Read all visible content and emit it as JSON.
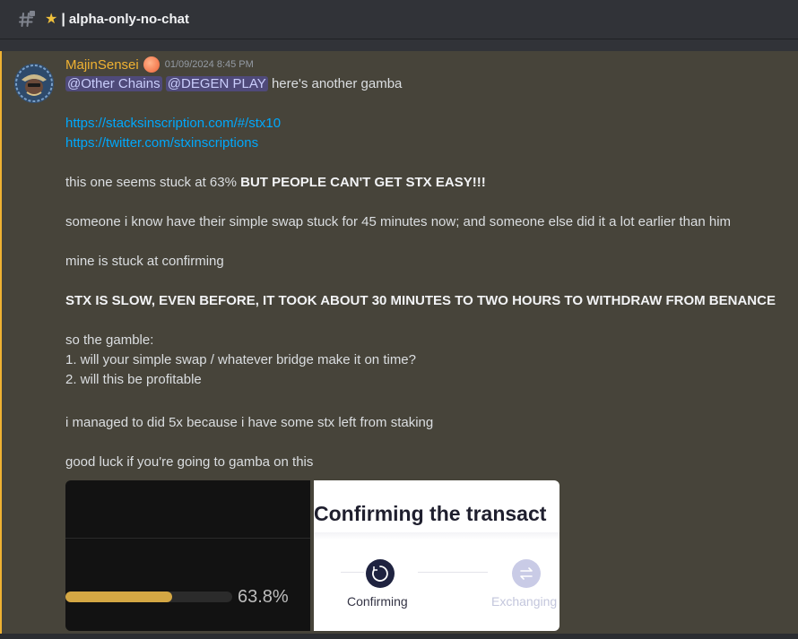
{
  "header": {
    "channel_icon": "text-channel-lock-icon",
    "star_icon": "star-icon",
    "separator": "|",
    "channel_name": "alpha-only-no-chat"
  },
  "message": {
    "username": "MajinSensei",
    "badge_icon": "peach-icon",
    "timestamp": "01/09/2024 8:45 PM",
    "mentions": [
      "@Other Chains",
      "@DEGEN PLAY"
    ],
    "first_line_rest": "here's another gamba",
    "links": [
      "https://stacksinscription.com/#/stx10",
      "https://twitter.com/stxinscriptions"
    ],
    "line_stuck_prefix": "this one seems stuck at 63% ",
    "line_stuck_bold": "BUT PEOPLE CAN'T GET STX EASY!!!",
    "line_someone": "someone i know have their simple swap stuck for 45 minutes now; and someone else did it a lot earlier than him",
    "line_mine": "mine is stuck at confirming",
    "line_stx_slow": "STX IS SLOW, EVEN BEFORE, IT TOOK ABOUT 30 MINUTES TO TWO HOURS TO WITHDRAW FROM BENANCE",
    "line_gamble": "so the gamble:",
    "line_q1": "1. will your simple swap / whatever bridge make it on time?",
    "line_q2": "2. will this be profitable",
    "line_managed": "i managed to did 5x because i have some stx left from staking",
    "line_luck": "good luck if you're going to gamba on this"
  },
  "attachment": {
    "progress_value": 0.638,
    "progress_label": "63.8%",
    "confirm_title": "Confirming the transact",
    "step1_label": "Confirming",
    "step2_label": "Exchanging",
    "accent_color": "#d4a744"
  },
  "colors": {
    "username": "#f0b232",
    "highlight_bg": "#47443a",
    "link": "#00a8fc",
    "mention_bg": "#4f4a7a"
  }
}
